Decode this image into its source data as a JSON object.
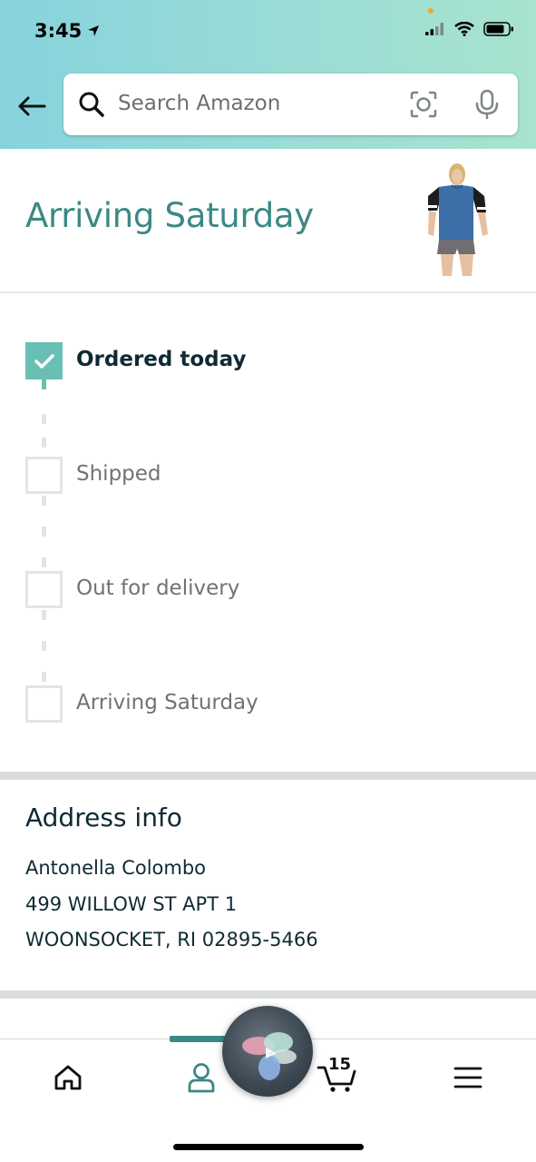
{
  "status_bar": {
    "time": "3:45"
  },
  "search": {
    "placeholder": "Search Amazon"
  },
  "shipment": {
    "headline": "Arriving Saturday",
    "steps": [
      {
        "label": "Ordered today",
        "completed": true
      },
      {
        "label": "Shipped",
        "completed": false
      },
      {
        "label": "Out for delivery",
        "completed": false
      },
      {
        "label": "Arriving Saturday",
        "completed": false
      }
    ]
  },
  "address": {
    "title": "Address info",
    "lines": [
      "Antonella Colombo",
      "499 WILLOW ST APT 1",
      "WOONSOCKET, RI 02895-5466"
    ]
  },
  "bottom_nav": {
    "items": [
      "home-icon",
      "account-icon",
      "alexa-icon",
      "cart-icon",
      "menu-icon"
    ],
    "active": "account-icon",
    "cart_count": "15"
  },
  "colors": {
    "accent": "#3b8985",
    "check": "#69bfb4"
  }
}
